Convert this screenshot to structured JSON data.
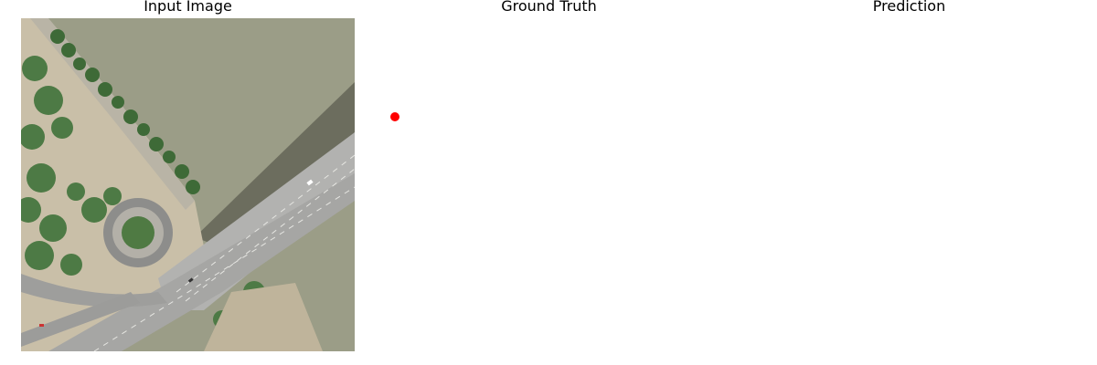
{
  "titles": {
    "input": "Input Image",
    "ground_truth": "Ground Truth",
    "prediction": "Prediction"
  },
  "colors": {
    "water": "#9a9c86",
    "road": "#a9a9a7",
    "vegetation": "#3f6b3a",
    "marker": "#ff0000"
  }
}
